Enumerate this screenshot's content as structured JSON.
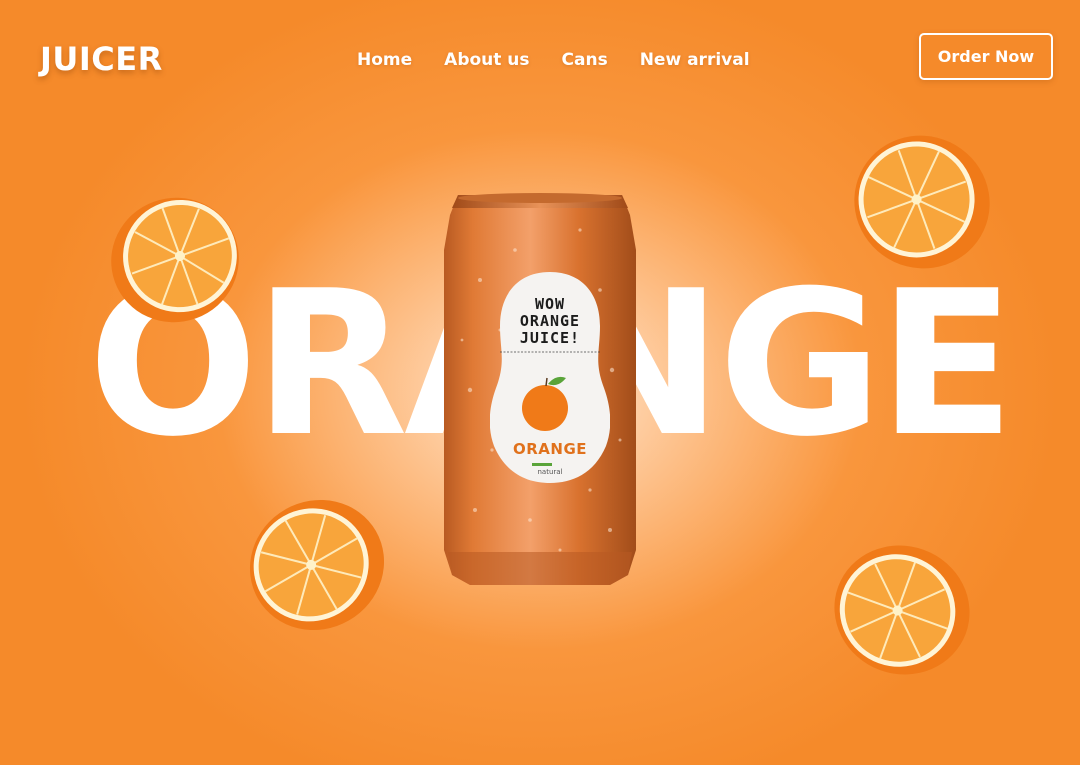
{
  "brand": {
    "logo": "JUICER"
  },
  "nav": {
    "items": [
      {
        "label": "Home"
      },
      {
        "label": "About us"
      },
      {
        "label": "Cans"
      },
      {
        "label": "New arrival"
      }
    ]
  },
  "header": {
    "cta_label": "Order Now"
  },
  "hero": {
    "word": "ORANGE",
    "can_label": {
      "lines": [
        "WOW",
        "ORANGE",
        "JUICE!"
      ],
      "product": "ORANGE",
      "note": "natural"
    }
  },
  "colors": {
    "accent": "#f58a2a",
    "text": "#ffffff",
    "can": "#e07a35",
    "label_brand": "#e0711c"
  }
}
